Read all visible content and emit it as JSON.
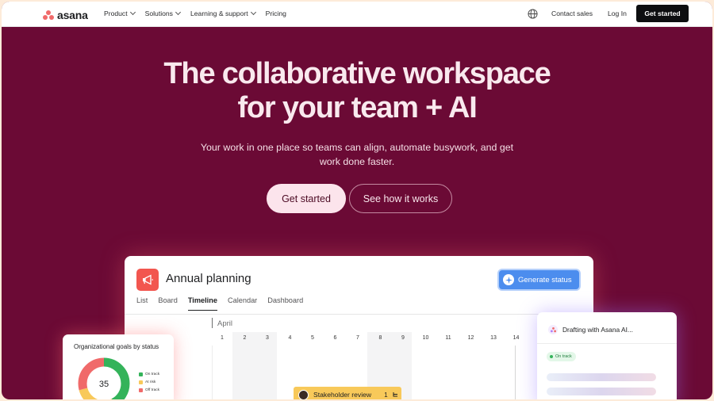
{
  "nav": {
    "logo_text": "asana",
    "menu": [
      {
        "label": "Product",
        "has_dropdown": true
      },
      {
        "label": "Solutions",
        "has_dropdown": true
      },
      {
        "label": "Learning & support",
        "has_dropdown": true
      },
      {
        "label": "Pricing",
        "has_dropdown": false
      }
    ],
    "globe_icon": "globe-icon",
    "contact_label": "Contact sales",
    "login_label": "Log In",
    "cta_label": "Get started"
  },
  "hero": {
    "title_line1": "The collaborative workspace",
    "title_line2": "for your team + AI",
    "subtitle_line1": "Your work in one place so teams can align, automate busywork, and get",
    "subtitle_line2": "work done faster.",
    "primary_label": "Get started",
    "secondary_label": "See how it works"
  },
  "app": {
    "icon": "megaphone-icon",
    "title": "Annual planning",
    "generate_label": "Generate status",
    "tabs": [
      {
        "label": "List",
        "active": false
      },
      {
        "label": "Board",
        "active": false
      },
      {
        "label": "Timeline",
        "active": true
      },
      {
        "label": "Calendar",
        "active": false
      },
      {
        "label": "Dashboard",
        "active": false
      }
    ],
    "month": "April",
    "days": [
      "1",
      "2",
      "3",
      "4",
      "5",
      "6",
      "7",
      "8",
      "9",
      "10",
      "11",
      "12",
      "13",
      "14"
    ],
    "task": {
      "label": "Stakeholder review",
      "count": "1"
    }
  },
  "goals": {
    "title": "Organizational goals by status",
    "total": "35",
    "legend": [
      {
        "label": "On track",
        "color": "#34b35a"
      },
      {
        "label": "At risk",
        "color": "#f8c95a"
      },
      {
        "label": "Off track",
        "color": "#f06a6a"
      }
    ]
  },
  "ai": {
    "title": "Drafting with Asana AI...",
    "badge": "On track"
  },
  "colors": {
    "hero_bg": "#6b0a35",
    "accent_blue": "#4c8dee",
    "brand_coral": "#f06a6a"
  }
}
